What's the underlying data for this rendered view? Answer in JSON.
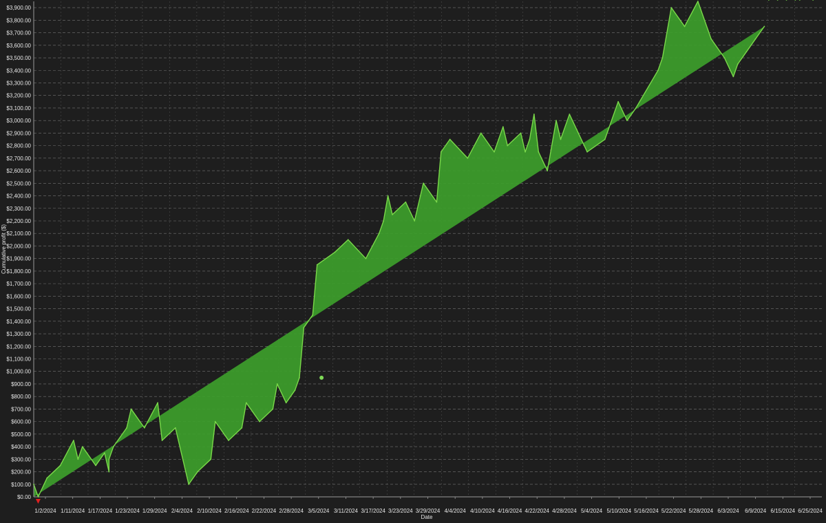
{
  "chart_data": {
    "type": "area",
    "xlabel": "Date",
    "ylabel": "Cumulative profit ($)",
    "ylim": [
      0,
      3950
    ],
    "yticks": [
      0,
      100,
      200,
      300,
      400,
      500,
      600,
      700,
      800,
      900,
      1000,
      1100,
      1200,
      1300,
      1400,
      1500,
      1600,
      1700,
      1800,
      1900,
      2000,
      2100,
      2200,
      2300,
      2400,
      2500,
      2600,
      2700,
      2800,
      2900,
      3000,
      3100,
      3200,
      3300,
      3400,
      3500,
      3600,
      3700,
      3800,
      3900
    ],
    "ytick_labels": [
      "$0.00",
      "$100.00",
      "$200.00",
      "$300.00",
      "$400.00",
      "$500.00",
      "$600.00",
      "$700.00",
      "$800.00",
      "$900.00",
      "$1,000.00",
      "$1,100.00",
      "$1,200.00",
      "$1,300.00",
      "$1,400.00",
      "$1,500.00",
      "$1,600.00",
      "$1,700.00",
      "$1,800.00",
      "$1,900.00",
      "$2,000.00",
      "$2,100.00",
      "$2,200.00",
      "$2,300.00",
      "$2,400.00",
      "$2,500.00",
      "$2,600.00",
      "$2,700.00",
      "$2,800.00",
      "$2,900.00",
      "$3,000.00",
      "$3,100.00",
      "$3,200.00",
      "$3,300.00",
      "$3,400.00",
      "$3,500.00",
      "$3,600.00",
      "$3,700.00",
      "$3,800.00",
      "$3,900.00"
    ],
    "xtick_labels": [
      "1/2/2024",
      "1/11/2024",
      "1/17/2024",
      "1/23/2024",
      "1/29/2024",
      "2/4/2024",
      "2/10/2024",
      "2/16/2024",
      "2/22/2024",
      "2/28/2024",
      "3/5/2024",
      "3/11/2024",
      "3/17/2024",
      "3/23/2024",
      "3/29/2024",
      "4/4/2024",
      "4/10/2024",
      "4/16/2024",
      "4/22/2024",
      "4/28/2024",
      "5/4/2024",
      "5/10/2024",
      "5/16/2024",
      "5/22/2024",
      "5/28/2024",
      "6/3/2024",
      "6/9/2024",
      "6/15/2024",
      "6/25/2024"
    ],
    "x": [
      "2023-12-31",
      "2024-01-01",
      "2024-01-03",
      "2024-01-06",
      "2024-01-09",
      "2024-01-10",
      "2024-01-11",
      "2024-01-14",
      "2024-01-16",
      "2024-01-17",
      "2024-01-17",
      "2024-01-18",
      "2024-01-21",
      "2024-01-22",
      "2024-01-25",
      "2024-01-28",
      "2024-01-29",
      "2024-02-01",
      "2024-02-04",
      "2024-02-06",
      "2024-02-09",
      "2024-02-10",
      "2024-02-13",
      "2024-02-16",
      "2024-02-17",
      "2024-02-20",
      "2024-02-23",
      "2024-02-24",
      "2024-02-26",
      "2024-02-28",
      "2024-02-29",
      "2024-03-01",
      "2024-03-03",
      "2024-03-04",
      "2024-03-08",
      "2024-03-11",
      "2024-03-15",
      "2024-03-18",
      "2024-03-19",
      "2024-03-20",
      "2024-03-21",
      "2024-03-24",
      "2024-03-26",
      "2024-03-28",
      "2024-03-31",
      "2024-04-01",
      "2024-04-03",
      "2024-04-07",
      "2024-04-10",
      "2024-04-13",
      "2024-04-14",
      "2024-04-15",
      "2024-04-16",
      "2024-04-19",
      "2024-04-20",
      "2024-04-21",
      "2024-04-22",
      "2024-04-23",
      "2024-04-25",
      "2024-04-27",
      "2024-04-28",
      "2024-04-30",
      "2024-05-04",
      "2024-05-08",
      "2024-05-11",
      "2024-05-13",
      "2024-05-15",
      "2024-05-20",
      "2024-05-21",
      "2024-05-23",
      "2024-05-26",
      "2024-05-29",
      "2024-06-01",
      "2024-06-04",
      "2024-06-06",
      "2024-06-07",
      "2024-06-09",
      "2024-06-11",
      "2024-06-13",
      "2024-06-14",
      "2024-06-16",
      "2024-06-18",
      "2024-06-20",
      "2024-06-21",
      "2024-06-24"
    ],
    "values": [
      100,
      0,
      150,
      250,
      450,
      300,
      400,
      250,
      350,
      200,
      300,
      400,
      550,
      700,
      550,
      750,
      450,
      550,
      100,
      200,
      300,
      600,
      450,
      550,
      750,
      600,
      700,
      900,
      750,
      850,
      950,
      1350,
      1450,
      1850,
      1950,
      2050,
      1900,
      2100,
      2200,
      2400,
      2250,
      2350,
      2200,
      2500,
      2350,
      2750,
      2850,
      2700,
      2900,
      2750,
      2850,
      2950,
      2800,
      2900,
      2750,
      2850,
      3050,
      2750,
      2600,
      3000,
      2850,
      3050,
      2750,
      2850,
      3150,
      3000,
      3100,
      3400,
      3500,
      3900,
      3750,
      3950,
      3650,
      3500,
      3350,
      3450,
      3550,
      3650,
      3750
    ],
    "markers": [
      {
        "label": "entry",
        "x": "2024-01-01",
        "y": 0,
        "color": "#e02020"
      },
      {
        "label": "point",
        "x": "2024-03-05",
        "y": 950,
        "color": "#7ed957"
      }
    ],
    "grid": true,
    "colors": {
      "background": "#1e1e1e",
      "band_dark": "#232323",
      "band_light": "#3c3c3c",
      "fill": "#3d9e2b",
      "line": "#7ad84a",
      "grid": "#8a8a8a",
      "axis_text": "#e6e6e6"
    }
  }
}
